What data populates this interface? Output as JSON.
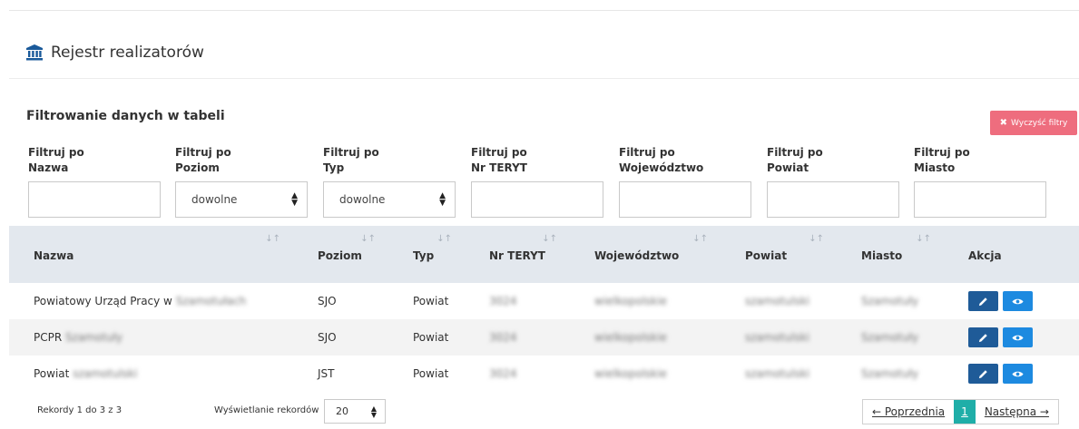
{
  "header": {
    "title": "Rejestr realizatorów"
  },
  "filters": {
    "heading": "Filtrowanie danych w tabeli",
    "clear_label": "Wyczyść filtry",
    "fields": [
      {
        "line1": "Filtruj po",
        "line2": "Nazwa",
        "type": "text",
        "value": ""
      },
      {
        "line1": "Filtruj po",
        "line2": "Poziom",
        "type": "select",
        "value": "dowolne"
      },
      {
        "line1": "Filtruj po",
        "line2": "Typ",
        "type": "select",
        "value": "dowolne"
      },
      {
        "line1": "Filtruj po",
        "line2": "Nr TERYT",
        "type": "text",
        "value": ""
      },
      {
        "line1": "Filtruj po",
        "line2": "Województwo",
        "type": "text",
        "value": ""
      },
      {
        "line1": "Filtruj po",
        "line2": "Powiat",
        "type": "text",
        "value": ""
      },
      {
        "line1": "Filtruj po",
        "line2": "Miasto",
        "type": "text",
        "value": ""
      }
    ]
  },
  "table": {
    "columns": [
      "Nazwa",
      "Poziom",
      "Typ",
      "Nr TERYT",
      "Województwo",
      "Powiat",
      "Miasto",
      "Akcja"
    ],
    "rows": [
      {
        "nazwa": "Powiatowy Urząd Pracy w",
        "nazwa_hidden": "Szamotułach",
        "poziom": "SJO",
        "typ": "Powiat",
        "teryt": "3024",
        "woj": "wielkopolskie",
        "powiat": "szamotulski",
        "miasto": "Szamotuły"
      },
      {
        "nazwa": "PCPR",
        "nazwa_hidden": "Szamotuły",
        "poziom": "SJO",
        "typ": "Powiat",
        "teryt": "3024",
        "woj": "wielkopolskie",
        "powiat": "szamotulski",
        "miasto": "Szamotuły"
      },
      {
        "nazwa": "Powiat",
        "nazwa_hidden": "szamotulski",
        "poziom": "JST",
        "typ": "Powiat",
        "teryt": "3024",
        "woj": "wielkopolskie",
        "powiat": "szamotulski",
        "miasto": "Szamotuły"
      }
    ]
  },
  "footer": {
    "records": "Rekordy 1 do 3 z 3",
    "show_label": "Wyświetlanie rekordów",
    "page_size": "20",
    "prev": "← Poprzednia",
    "current_page": "1",
    "next": "Następna →"
  },
  "colors": {
    "clear": "#ee6d7e",
    "edit": "#1f5b98",
    "view": "#1d8ae0",
    "page_active": "#1faea8",
    "header_bg": "#e3e8ee"
  },
  "icons": {
    "title": "bank-icon",
    "clear": "close-icon",
    "edit": "pencil-icon",
    "view": "eye-icon",
    "sort": "sort-icon"
  }
}
